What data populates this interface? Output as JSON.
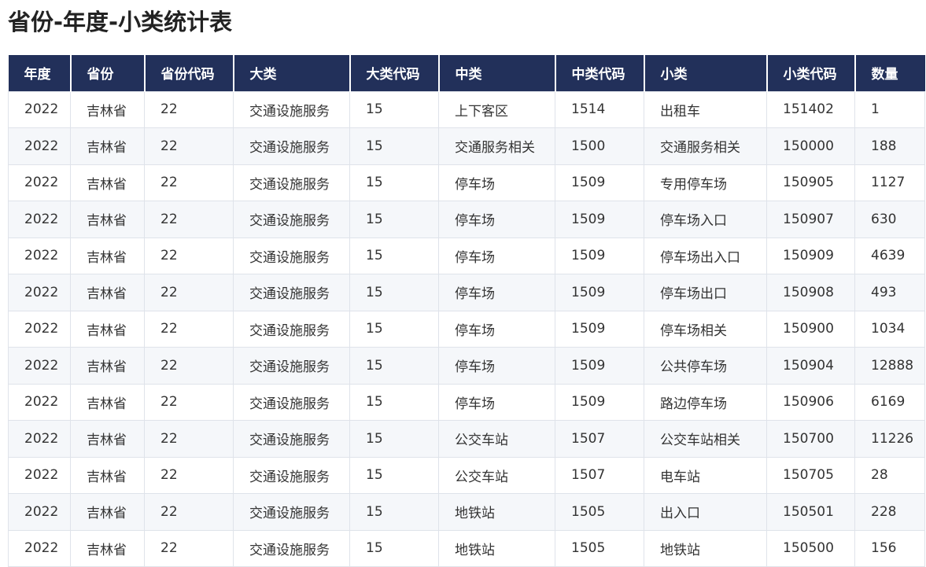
{
  "title": "省份-年度-小类统计表",
  "colors": {
    "header_bg": "#22305a",
    "header_text": "#ffffff",
    "row_alt_bg": "#f5f7fa",
    "grid": "#dfe3ea"
  },
  "table": {
    "columns": [
      "年度",
      "省份",
      "省份代码",
      "大类",
      "大类代码",
      "中类",
      "中类代码",
      "小类",
      "小类代码",
      "数量"
    ],
    "rows": [
      [
        "2022",
        "吉林省",
        "22",
        "交通设施服务",
        "15",
        "上下客区",
        "1514",
        "出租车",
        "151402",
        "1"
      ],
      [
        "2022",
        "吉林省",
        "22",
        "交通设施服务",
        "15",
        "交通服务相关",
        "1500",
        "交通服务相关",
        "150000",
        "188"
      ],
      [
        "2022",
        "吉林省",
        "22",
        "交通设施服务",
        "15",
        "停车场",
        "1509",
        "专用停车场",
        "150905",
        "1127"
      ],
      [
        "2022",
        "吉林省",
        "22",
        "交通设施服务",
        "15",
        "停车场",
        "1509",
        "停车场入口",
        "150907",
        "630"
      ],
      [
        "2022",
        "吉林省",
        "22",
        "交通设施服务",
        "15",
        "停车场",
        "1509",
        "停车场出入口",
        "150909",
        "4639"
      ],
      [
        "2022",
        "吉林省",
        "22",
        "交通设施服务",
        "15",
        "停车场",
        "1509",
        "停车场出口",
        "150908",
        "493"
      ],
      [
        "2022",
        "吉林省",
        "22",
        "交通设施服务",
        "15",
        "停车场",
        "1509",
        "停车场相关",
        "150900",
        "1034"
      ],
      [
        "2022",
        "吉林省",
        "22",
        "交通设施服务",
        "15",
        "停车场",
        "1509",
        "公共停车场",
        "150904",
        "12888"
      ],
      [
        "2022",
        "吉林省",
        "22",
        "交通设施服务",
        "15",
        "停车场",
        "1509",
        "路边停车场",
        "150906",
        "6169"
      ],
      [
        "2022",
        "吉林省",
        "22",
        "交通设施服务",
        "15",
        "公交车站",
        "1507",
        "公交车站相关",
        "150700",
        "11226"
      ],
      [
        "2022",
        "吉林省",
        "22",
        "交通设施服务",
        "15",
        "公交车站",
        "1507",
        "电车站",
        "150705",
        "28"
      ],
      [
        "2022",
        "吉林省",
        "22",
        "交通设施服务",
        "15",
        "地铁站",
        "1505",
        "出入口",
        "150501",
        "228"
      ],
      [
        "2022",
        "吉林省",
        "22",
        "交通设施服务",
        "15",
        "地铁站",
        "1505",
        "地铁站",
        "150500",
        "156"
      ]
    ]
  }
}
